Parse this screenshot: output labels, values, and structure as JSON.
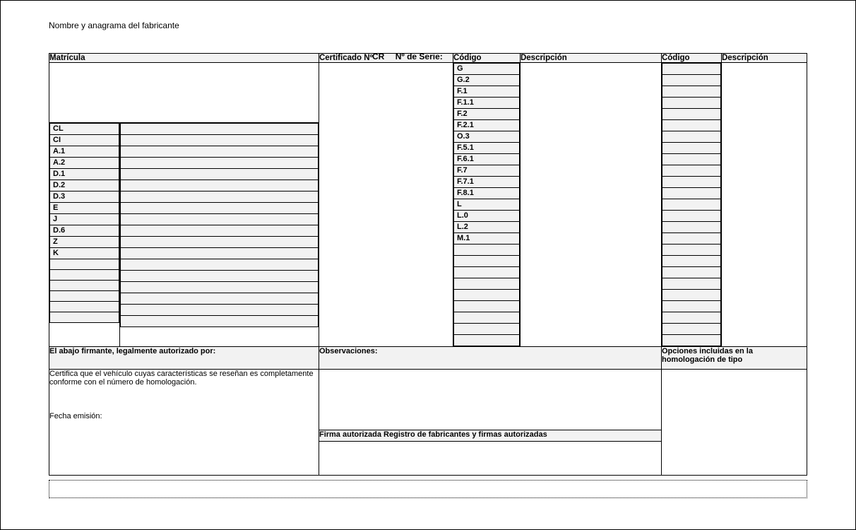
{
  "mfr_label": "Nombre y anagrama del fabricante",
  "serial": {
    "cr": "CR",
    "label": "Nº de Serie:"
  },
  "headers": {
    "matricula": "Matrícula",
    "certificado": "Certificado Nº",
    "codigo": "Código",
    "descripcion": "Descripción"
  },
  "left_codes": [
    "CL",
    "CI",
    "A.1",
    "A.2",
    "D.1",
    "D.2",
    "D.3",
    "E",
    "J",
    "D.6",
    "Z",
    "K",
    "",
    "",
    "",
    "",
    "",
    ""
  ],
  "mid_codes": [
    "G",
    "G.2",
    "F.1",
    "F.1.1",
    "F.2",
    "F.2.1",
    "O.3",
    "F.5.1",
    "F.6.1",
    "F.7",
    "F.7.1",
    "F.8.1",
    "L",
    "L.0",
    "L.2",
    "M.1",
    "",
    "",
    "",
    "",
    "",
    "",
    "",
    "",
    ""
  ],
  "right_codes_count": 25,
  "footer": {
    "signer": "El abajo firmante, legalmente autorizado por:",
    "certifies": "Certifica que el vehículo cuyas características se reseñan es completamente conforme con el número de homologación.",
    "fecha": "Fecha emisión:",
    "obs": "Observaciones:",
    "firma": "Firma autorizada Registro de fabricantes y firmas autorizadas",
    "opciones": "Opciones incluidas en la homologación de tipo"
  }
}
